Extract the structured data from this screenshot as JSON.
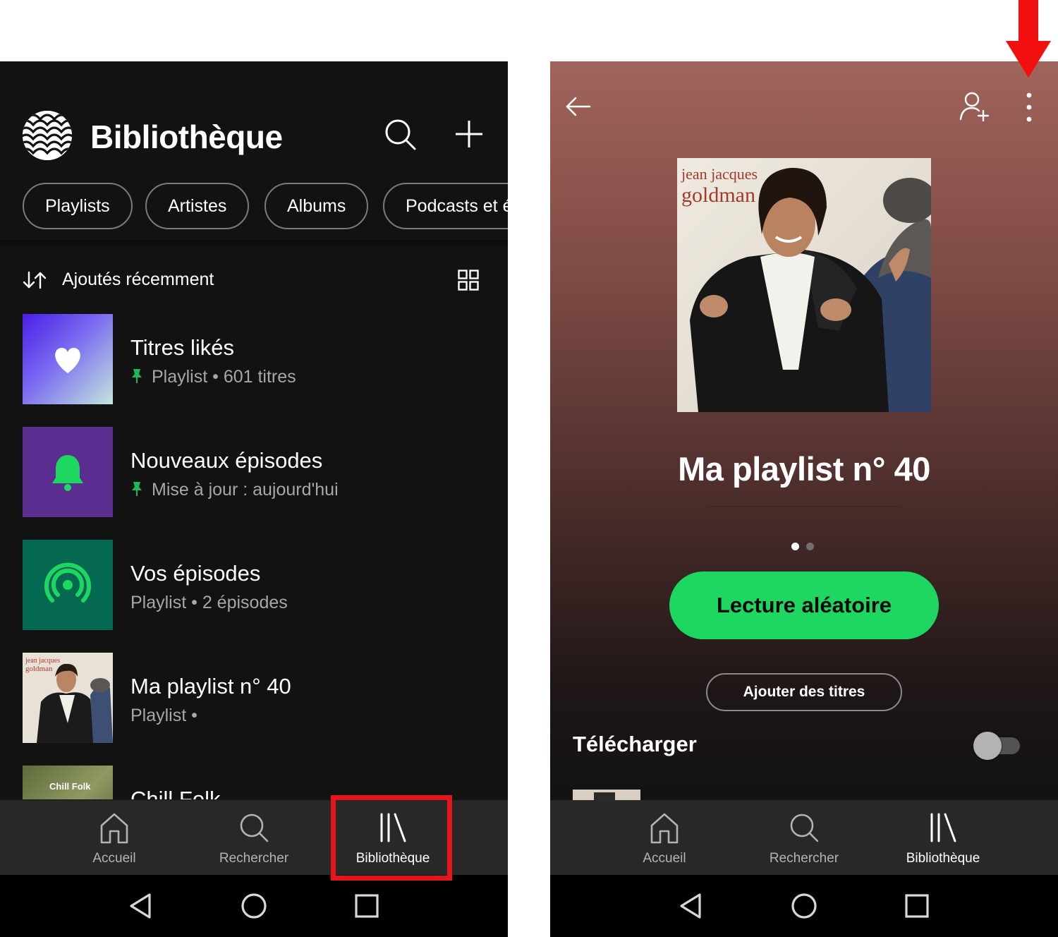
{
  "left_screen": {
    "header": {
      "title": "Bibliothèque",
      "search_icon": "search-icon",
      "add_icon": "plus-icon"
    },
    "filters": [
      "Playlists",
      "Artistes",
      "Albums",
      "Podcasts et émissions"
    ],
    "sort": {
      "label": "Ajoutés récemment",
      "sort_icon": "sort-arrows-icon",
      "view_icon": "grid-view-icon"
    },
    "items": [
      {
        "title": "Titres likés",
        "subtitle": "Playlist • 601 titres",
        "pinned": true,
        "thumb_icon": "heart-icon"
      },
      {
        "title": "Nouveaux épisodes",
        "subtitle": "Mise à jour : aujourd'hui",
        "pinned": true,
        "thumb_icon": "bell-icon"
      },
      {
        "title": "Vos épisodes",
        "subtitle": "Playlist • 2 épisodes",
        "pinned": false,
        "thumb_icon": "podcast-icon"
      },
      {
        "title": "Ma playlist n° 40",
        "subtitle": "Playlist •",
        "pinned": false,
        "thumb_icon": "album-cover"
      },
      {
        "title": "Chill Folk",
        "subtitle": "",
        "pinned": false,
        "thumb_label": "Chill Folk"
      }
    ],
    "nav": [
      {
        "label": "Accueil",
        "icon": "home-icon",
        "active": false
      },
      {
        "label": "Rechercher",
        "icon": "search-icon",
        "active": false
      },
      {
        "label": "Bibliothèque",
        "icon": "library-icon",
        "active": true
      }
    ]
  },
  "right_screen": {
    "header": {
      "back_icon": "back-arrow-icon",
      "add_user_icon": "add-user-icon",
      "more_icon": "more-vertical-icon"
    },
    "cover_text": [
      "jean jacques",
      "goldman"
    ],
    "playlist_title": "Ma playlist n° 40",
    "page_dots": {
      "count": 2,
      "active": 0
    },
    "shuffle_label": "Lecture aléatoire",
    "add_tracks_label": "Ajouter des titres",
    "download": {
      "label": "Télécharger",
      "enabled": false
    },
    "nav": [
      {
        "label": "Accueil",
        "icon": "home-icon",
        "active": false
      },
      {
        "label": "Rechercher",
        "icon": "search-icon",
        "active": false
      },
      {
        "label": "Bibliothèque",
        "icon": "library-icon",
        "active": true
      }
    ]
  },
  "system_nav": {
    "back_icon": "triangle-back-icon",
    "home_icon": "circle-home-icon",
    "recents_icon": "square-recents-icon"
  },
  "annotations": {
    "highlight_color": "#e8141b",
    "highlight_target": "Bibliothèque",
    "arrow_target": "more-vertical-icon"
  },
  "colors": {
    "spotify_green": "#1ed760",
    "background": "#121212",
    "navbar": "#282828",
    "pin_green": "#1db954"
  }
}
